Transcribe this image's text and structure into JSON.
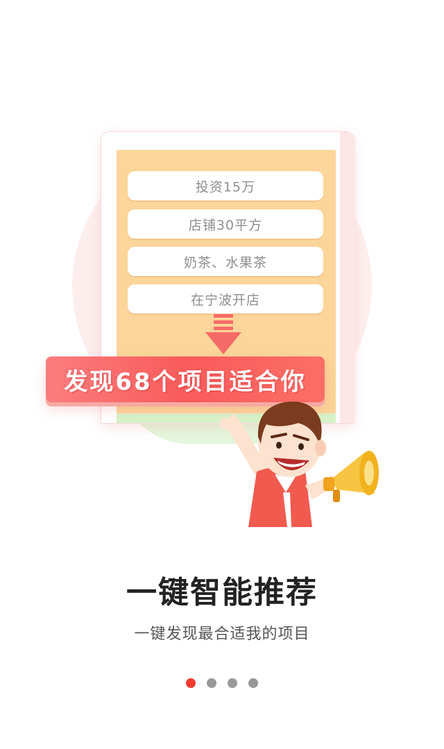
{
  "illustration": {
    "criteria": [
      {
        "label": "投资15万"
      },
      {
        "label": "店铺30平方"
      },
      {
        "label": "奶茶、水果茶"
      },
      {
        "label": "在宁波开店"
      }
    ],
    "result_banner": "发现68个项目适合你"
  },
  "title": "一键智能推荐",
  "subtitle": "一键发现最合适我的项目",
  "pager": {
    "count": 4,
    "active_index": 0,
    "active_color": "#f23b2f",
    "inactive_color": "#999999"
  },
  "colors": {
    "board": "#fbd59a",
    "banner": "#f95b5b",
    "arrow": "#f66b67"
  }
}
